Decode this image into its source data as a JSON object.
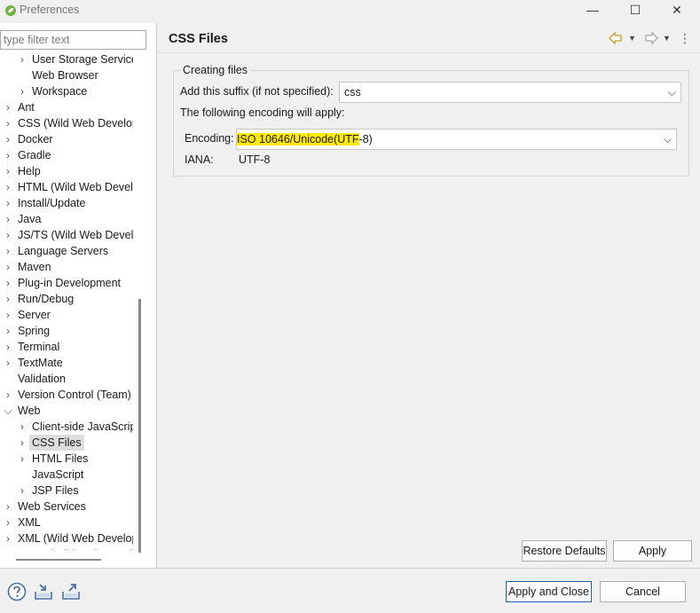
{
  "window": {
    "title": "Preferences",
    "minimize_label": "—",
    "maximize_label": "☐",
    "close_label": "✕"
  },
  "left": {
    "filter_placeholder": "type filter text",
    "tree": [
      {
        "label": "User Storage Service",
        "level": 1,
        "expander": "collapsed"
      },
      {
        "label": "Web Browser",
        "level": 1,
        "expander": "none"
      },
      {
        "label": "Workspace",
        "level": 1,
        "expander": "collapsed"
      },
      {
        "label": "Ant",
        "level": 0,
        "expander": "collapsed"
      },
      {
        "label": "CSS (Wild Web Developer)",
        "level": 0,
        "expander": "collapsed"
      },
      {
        "label": "Docker",
        "level": 0,
        "expander": "collapsed"
      },
      {
        "label": "Gradle",
        "level": 0,
        "expander": "collapsed"
      },
      {
        "label": "Help",
        "level": 0,
        "expander": "collapsed"
      },
      {
        "label": "HTML (Wild Web Developer)",
        "level": 0,
        "expander": "collapsed"
      },
      {
        "label": "Install/Update",
        "level": 0,
        "expander": "collapsed"
      },
      {
        "label": "Java",
        "level": 0,
        "expander": "collapsed"
      },
      {
        "label": "JS/TS (Wild Web Developer)",
        "level": 0,
        "expander": "collapsed"
      },
      {
        "label": "Language Servers",
        "level": 0,
        "expander": "collapsed"
      },
      {
        "label": "Maven",
        "level": 0,
        "expander": "collapsed"
      },
      {
        "label": "Plug-in Development",
        "level": 0,
        "expander": "collapsed"
      },
      {
        "label": "Run/Debug",
        "level": 0,
        "expander": "collapsed"
      },
      {
        "label": "Server",
        "level": 0,
        "expander": "collapsed"
      },
      {
        "label": "Spring",
        "level": 0,
        "expander": "collapsed"
      },
      {
        "label": "Terminal",
        "level": 0,
        "expander": "collapsed"
      },
      {
        "label": "TextMate",
        "level": 0,
        "expander": "collapsed"
      },
      {
        "label": "Validation",
        "level": 0,
        "expander": "none"
      },
      {
        "label": "Version Control (Team)",
        "level": 0,
        "expander": "collapsed"
      },
      {
        "label": "Web",
        "level": 0,
        "expander": "expanded"
      },
      {
        "label": "Client-side JavaScript",
        "level": 1,
        "expander": "collapsed"
      },
      {
        "label": "CSS Files",
        "level": 1,
        "expander": "collapsed",
        "selected": true
      },
      {
        "label": "HTML Files",
        "level": 1,
        "expander": "collapsed"
      },
      {
        "label": "JavaScript",
        "level": 1,
        "expander": "none"
      },
      {
        "label": "JSP Files",
        "level": 1,
        "expander": "collapsed"
      },
      {
        "label": "Web Services",
        "level": 0,
        "expander": "collapsed"
      },
      {
        "label": "XML",
        "level": 0,
        "expander": "collapsed"
      },
      {
        "label": "XML (Wild Web Developer)",
        "level": 0,
        "expander": "collapsed"
      },
      {
        "label": "YAML (Wild Web Developer)",
        "level": 0,
        "expander": "collapsed"
      }
    ]
  },
  "page": {
    "title": "CSS Files",
    "group_title": "Creating files",
    "suffix_label": "Add this suffix (if not specified):",
    "suffix_value": "css",
    "encoding_note": "The following encoding will apply:",
    "encoding_label": "Encoding:",
    "encoding_value_highlight": "ISO 10646/Unicode(UTF",
    "encoding_value_rest": "-8)",
    "iana_label": "IANA:",
    "iana_value": "UTF-8",
    "restore_defaults": "Restore Defaults",
    "apply": "Apply"
  },
  "footer": {
    "apply_and_close": "Apply and Close",
    "cancel": "Cancel"
  },
  "icons": {
    "back": "back-arrow-icon",
    "forward": "forward-arrow-icon",
    "menu": "view-menu-icon",
    "help": "help-icon",
    "import": "import-icon",
    "export": "export-icon"
  },
  "colors": {
    "highlight": "#ffea00",
    "nav_arrow": "#c9a02a",
    "default_button_border": "#1a5fb4"
  }
}
